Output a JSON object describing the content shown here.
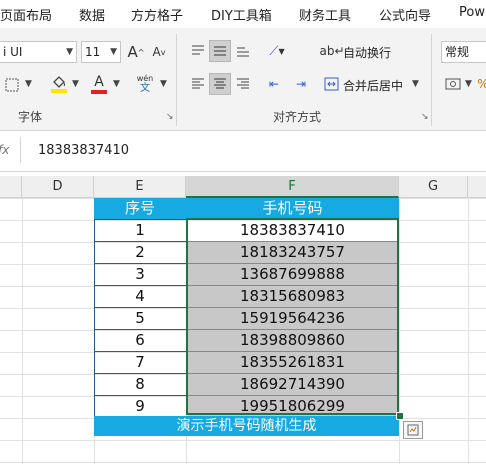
{
  "tabs": [
    "页面布局",
    "数据",
    "方方格子",
    "DIY工具箱",
    "财务工具",
    "公式向导",
    "Pow"
  ],
  "ribbon": {
    "font_name": "i UI",
    "font_size": "11",
    "font_group_label": "字体",
    "align_group_label": "对齐方式",
    "wrap_text_label": "自动换行",
    "merge_center_label": "合并后居中",
    "number_format": "常规",
    "phonetic_top": "wén",
    "phonetic_bottom": "文",
    "grow_font": "A",
    "shrink_font": "A",
    "font_color_glyph": "A",
    "colors": {
      "fill": "#ffe500",
      "font": "#e32020"
    }
  },
  "formula_bar": {
    "fx": "fx",
    "value": "18383837410"
  },
  "grid": {
    "columns": [
      "D",
      "E",
      "F",
      "G"
    ],
    "selected_column": "F",
    "header_seq": "序号",
    "header_phone": "手机号码",
    "rows": [
      {
        "seq": "1",
        "phone": "18383837410"
      },
      {
        "seq": "2",
        "phone": "18183243757"
      },
      {
        "seq": "3",
        "phone": "13687699888"
      },
      {
        "seq": "4",
        "phone": "18315680983"
      },
      {
        "seq": "5",
        "phone": "15919564236"
      },
      {
        "seq": "6",
        "phone": "18398809860"
      },
      {
        "seq": "7",
        "phone": "18355261831"
      },
      {
        "seq": "8",
        "phone": "18692714390"
      },
      {
        "seq": "9",
        "phone": "19951806299"
      }
    ],
    "footer": "演示手机号码随机生成",
    "accent": "#17a9e1",
    "selection_color": "#217346"
  }
}
